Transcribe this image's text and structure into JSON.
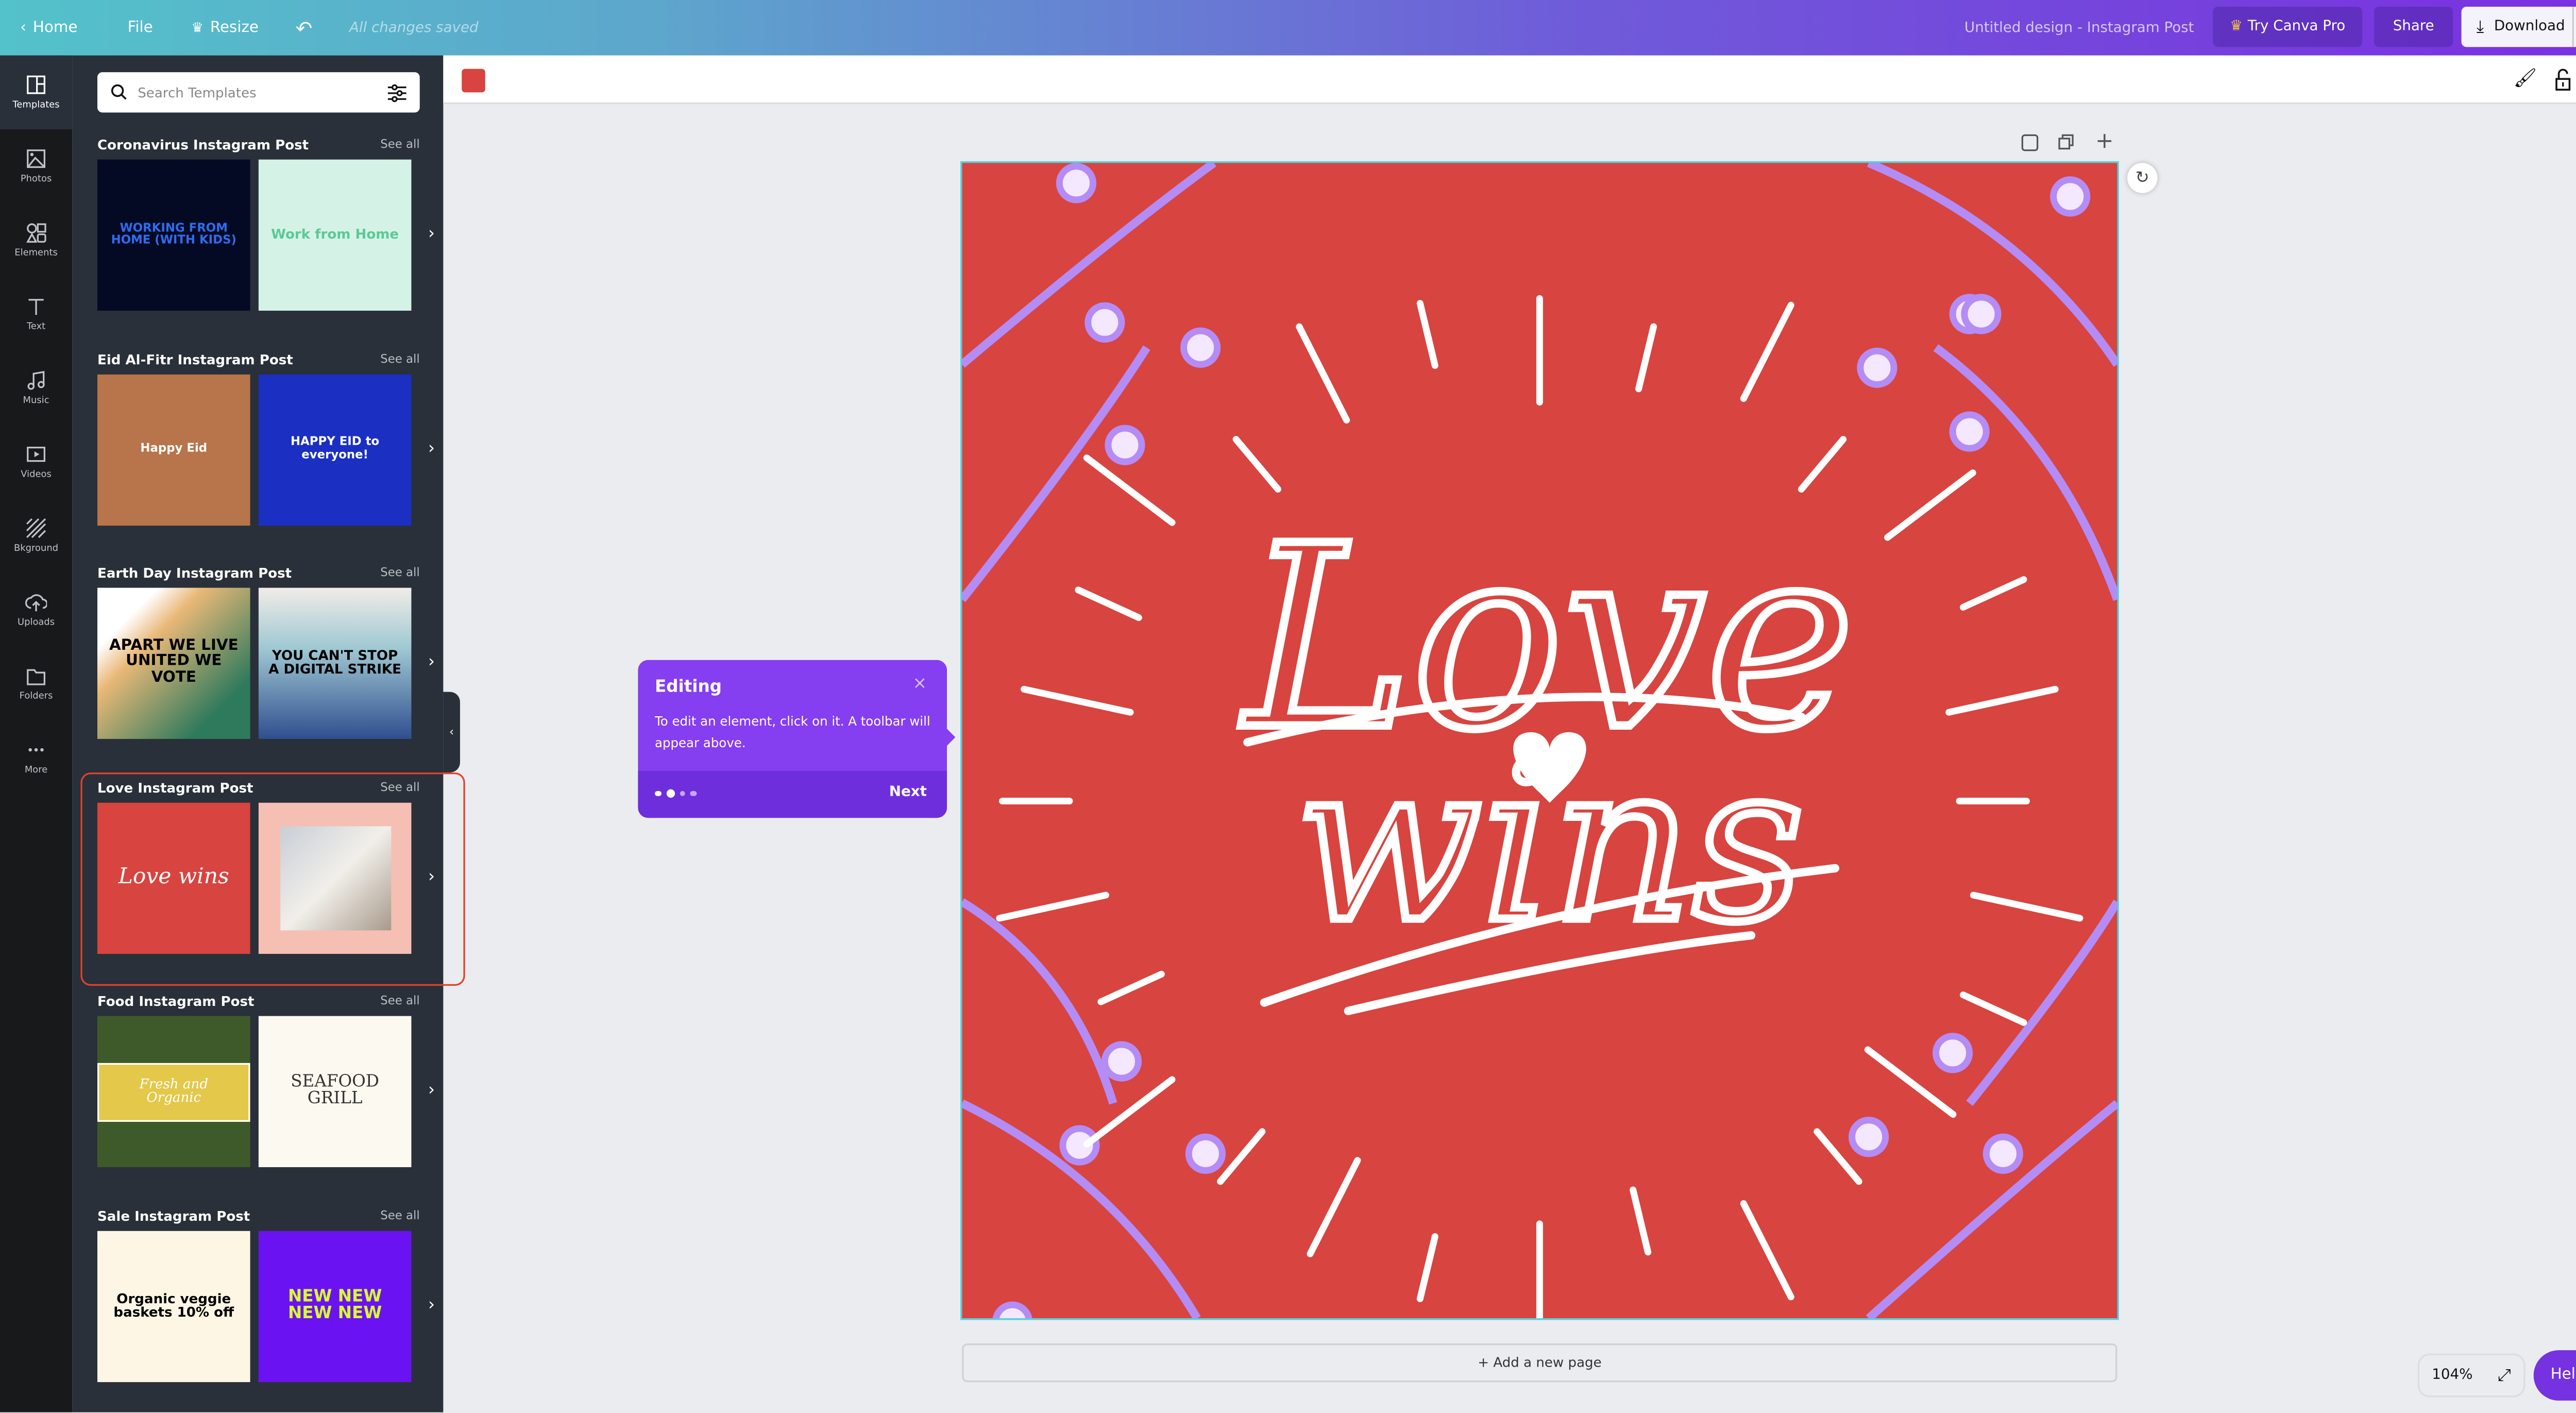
{
  "topbar": {
    "home": "Home",
    "file": "File",
    "resize": "Resize",
    "status": "All changes saved",
    "design_title": "Untitled design - Instagram Post",
    "try_pro": "Try Canva Pro",
    "share": "Share",
    "download": "Download"
  },
  "rail": [
    {
      "label": "Templates",
      "icon": "templates-icon"
    },
    {
      "label": "Photos",
      "icon": "photos-icon"
    },
    {
      "label": "Elements",
      "icon": "elements-icon"
    },
    {
      "label": "Text",
      "icon": "text-icon"
    },
    {
      "label": "Music",
      "icon": "music-icon"
    },
    {
      "label": "Videos",
      "icon": "videos-icon"
    },
    {
      "label": "Bkground",
      "icon": "background-icon"
    },
    {
      "label": "Uploads",
      "icon": "uploads-icon"
    },
    {
      "label": "Folders",
      "icon": "folders-icon"
    },
    {
      "label": "More",
      "icon": "more-icon"
    }
  ],
  "panel": {
    "search_placeholder": "Search Templates",
    "see_all": "See all",
    "sections": [
      {
        "title": "Coronavirus Instagram Post",
        "thumbs": [
          "WORKING FROM HOME (WITH KIDS)",
          "Work from Home"
        ]
      },
      {
        "title": "Eid Al-Fitr Instagram Post",
        "thumbs": [
          "Happy Eid",
          "HAPPY EID to everyone!"
        ]
      },
      {
        "title": "Earth Day Instagram Post",
        "thumbs": [
          "APART WE LIVE UNITED WE VOTE",
          "YOU CAN'T STOP A DIGITAL STRIKE"
        ]
      },
      {
        "title": "Love Instagram Post",
        "thumbs": [
          "Love wins",
          ""
        ]
      },
      {
        "title": "Food Instagram Post",
        "thumbs": [
          "Fresh and Organic",
          "SEAFOOD GRILL"
        ]
      },
      {
        "title": "Sale Instagram Post",
        "thumbs": [
          "Organic veggie baskets 10% off",
          "NEW NEW NEW NEW"
        ]
      }
    ]
  },
  "canvas": {
    "bg_color": "#d8443f",
    "text_line1": "Love",
    "text_line2": "wins",
    "add_page": "+ Add a new page"
  },
  "tooltip": {
    "title": "Editing",
    "body": "To edit an element, click on it. A toolbar will appear above.",
    "next": "Next",
    "step": 2,
    "total_steps": 4
  },
  "footer": {
    "zoom": "104%",
    "help": "Help",
    "help_icon": "?"
  }
}
